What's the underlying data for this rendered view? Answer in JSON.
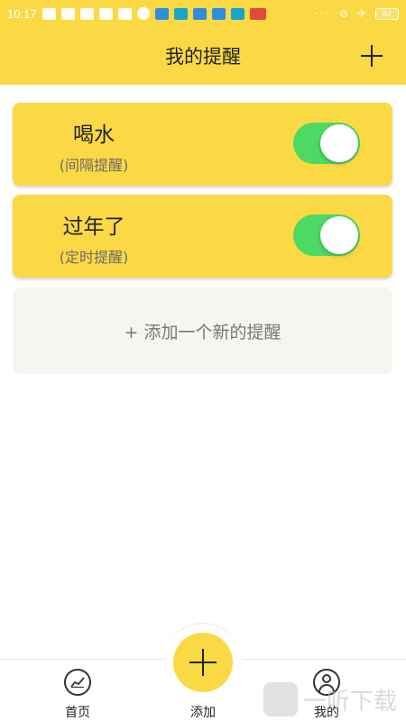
{
  "status_bar": {
    "time": "10:17",
    "dots": "···",
    "battery": "82"
  },
  "header": {
    "title": "我的提醒"
  },
  "reminders": [
    {
      "name": "喝水",
      "type": "(间隔提醒)",
      "enabled": true
    },
    {
      "name": "过年了",
      "type": "(定时提醒)",
      "enabled": true
    }
  ],
  "add_new": {
    "label": "+ 添加一个新的提醒"
  },
  "bottom_nav": {
    "home_label": "首页",
    "add_label": "添加",
    "mine_label": "我的"
  },
  "watermark": {
    "text": "一听下载"
  },
  "colors": {
    "primary": "#fbd945",
    "toggle_on": "#4cd964",
    "add_card_bg": "#f6f6f1"
  }
}
